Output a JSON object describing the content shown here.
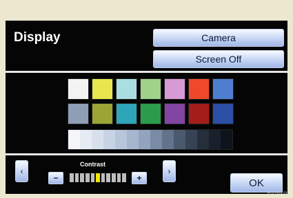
{
  "screen": {
    "title": "Display",
    "camera_label": "Camera",
    "screen_off_label": "Screen Off",
    "contrast_label": "Contrast",
    "minus_label": "−",
    "plus_label": "+",
    "prev_label": "‹",
    "next_label": "›",
    "ok_label": "OK",
    "code": "I51GS002U"
  },
  "swatches": [
    "#f3f3f3",
    "#e8e64e",
    "#a9dfe0",
    "#9fd38a",
    "#d69bd5",
    "#ee4a2a",
    "#4f7ed0",
    "#8e9eb5",
    "#9aa535",
    "#2fa5b8",
    "#2b9c4c",
    "#8245a2",
    "#a51d1b",
    "#2c4fa6"
  ],
  "grayscale": [
    "#f4f6fa",
    "#e6ebf3",
    "#d8e0ec",
    "#c8d3e5",
    "#b8c6dc",
    "#a7b6cf",
    "#92a3bf",
    "#7a8ba6",
    "#63738c",
    "#4b596e",
    "#374255",
    "#262e3c",
    "#18202b",
    "#0f141c"
  ],
  "contrast": {
    "ticks": 11,
    "level": 6
  },
  "colors": {
    "background": "#ece8cf",
    "screen": "#050505",
    "accent": "#f2e600"
  }
}
